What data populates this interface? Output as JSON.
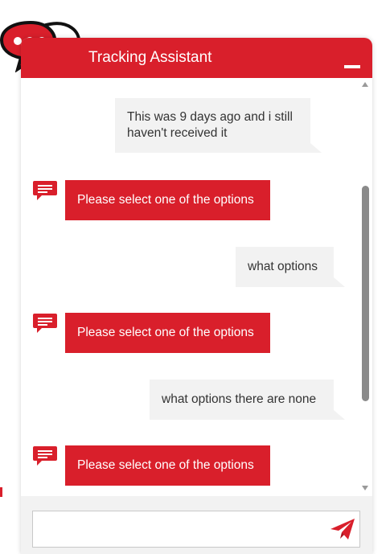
{
  "header": {
    "title": "Tracking Assistant"
  },
  "messages": [
    {
      "from": "user",
      "lines": [
        "This was 9 days ago and i still",
        "haven't received it"
      ]
    },
    {
      "from": "bot",
      "text": "Please select one of the options"
    },
    {
      "from": "user",
      "lines": [
        "what options"
      ]
    },
    {
      "from": "bot",
      "text": "Please select one of the options"
    },
    {
      "from": "user",
      "lines": [
        "what options there are none"
      ]
    },
    {
      "from": "bot",
      "text": "Please select one of the options"
    }
  ],
  "input": {
    "value": "",
    "placeholder": ""
  },
  "icons": {
    "logo": "speech-bubbles-logo-icon",
    "minimize": "minimize-icon",
    "bot": "chat-bubble-icon",
    "send": "paper-plane-send-icon"
  },
  "colors": {
    "brand_red": "#d91f2b",
    "user_bubble": "#f2f2f2",
    "text": "#333333"
  }
}
